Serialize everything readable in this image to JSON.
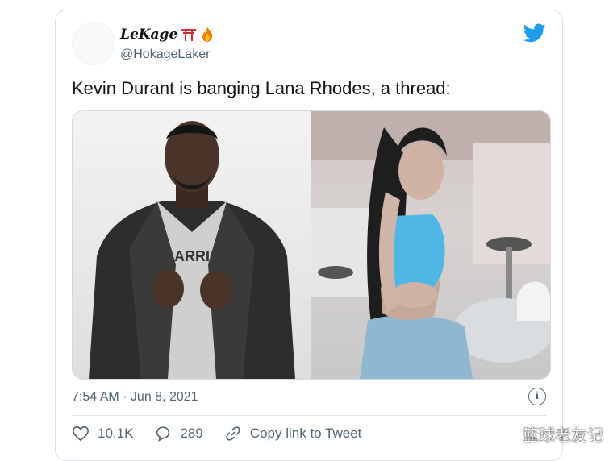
{
  "tweet": {
    "display_name": "LeKage",
    "handle": "@HokageLaker",
    "text": "Kevin Durant is banging Lana Rhodes, a thread:",
    "timestamp": "7:54 AM · Jun 8, 2021"
  },
  "actions": {
    "likes": "10.1K",
    "replies": "289",
    "copy_link_label": "Copy link to Tweet"
  },
  "media": {
    "shirt_text": "ARRIC"
  },
  "watermark": "篮球老友记",
  "colors": {
    "twitter_blue": "#1d9bf0",
    "secondary_text": "#536471",
    "border": "#dcdfe3"
  },
  "icons": [
    "torii-gate-icon",
    "fire-icon",
    "twitter-bird-icon",
    "info-icon",
    "heart-icon",
    "reply-bubble-icon",
    "link-icon"
  ]
}
